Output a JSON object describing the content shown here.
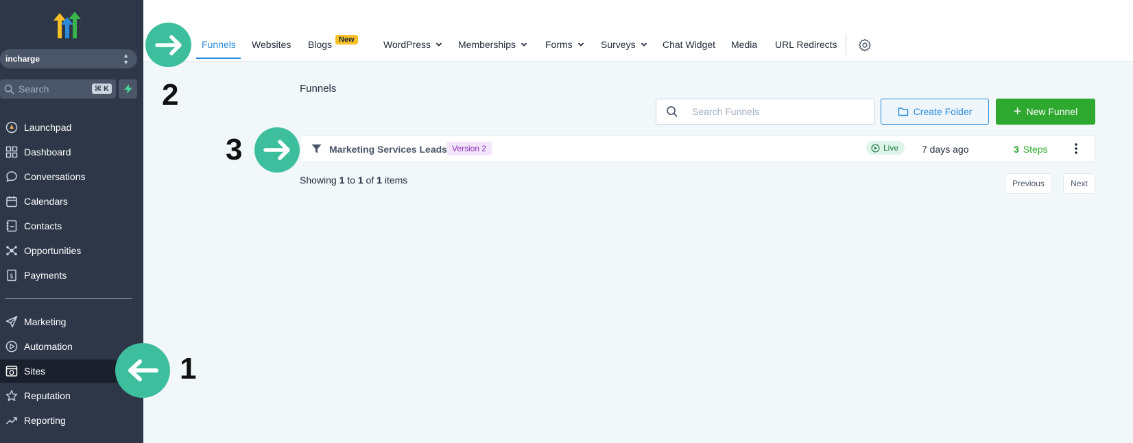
{
  "sidebar": {
    "account_name": "incharge",
    "search_placeholder": "Search",
    "search_shortcut": "⌘ K",
    "items": [
      {
        "label": "Launchpad",
        "icon": "launchpad-icon"
      },
      {
        "label": "Dashboard",
        "icon": "dashboard-icon"
      },
      {
        "label": "Conversations",
        "icon": "chat-bubble-icon"
      },
      {
        "label": "Calendars",
        "icon": "calendar-icon"
      },
      {
        "label": "Contacts",
        "icon": "contacts-icon"
      },
      {
        "label": "Opportunities",
        "icon": "opportunities-icon"
      },
      {
        "label": "Payments",
        "icon": "payments-icon"
      },
      {
        "label": "Marketing",
        "icon": "send-icon"
      },
      {
        "label": "Automation",
        "icon": "automation-icon"
      },
      {
        "label": "Sites",
        "icon": "sites-icon",
        "active": true
      },
      {
        "label": "Reputation",
        "icon": "star-icon"
      },
      {
        "label": "Reporting",
        "icon": "trend-icon"
      }
    ]
  },
  "topnav": {
    "tabs": [
      {
        "label": "Funnels",
        "active": true
      },
      {
        "label": "Websites"
      },
      {
        "label": "Blogs"
      },
      {
        "label": "WordPress",
        "dropdown": true
      },
      {
        "label": "Memberships",
        "dropdown": true
      },
      {
        "label": "Forms",
        "dropdown": true
      },
      {
        "label": "Surveys",
        "dropdown": true
      },
      {
        "label": "Chat Widget"
      },
      {
        "label": "Media"
      },
      {
        "label": "URL Redirects"
      }
    ],
    "blogs_badge": "New"
  },
  "main": {
    "title": "Funnels",
    "search_placeholder": "Search Funnels",
    "create_folder_label": "Create Folder",
    "new_funnel_label": "New Funnel",
    "funnels": [
      {
        "name": "Marketing Services Leads",
        "version": "Version 2",
        "status": "Live",
        "updated": "7 days ago",
        "step_count": "3",
        "steps_label": "Steps"
      }
    ],
    "pagination": {
      "showing_prefix": "Showing",
      "from": "1",
      "to_word": "to",
      "to": "1",
      "of_word": "of",
      "total": "1",
      "items_word": "items",
      "previous_label": "Previous",
      "next_label": "Next"
    }
  },
  "annotations": [
    {
      "number": "1",
      "direction": "left"
    },
    {
      "number": "2",
      "direction": "right"
    },
    {
      "number": "3",
      "direction": "right"
    }
  ],
  "colors": {
    "sidebar_bg": "#2d3748",
    "accent_blue": "#2b8ad8",
    "primary_green": "#2ea82e",
    "annotation_teal": "#3dbf9e",
    "badge_yellow": "#f6c026"
  }
}
